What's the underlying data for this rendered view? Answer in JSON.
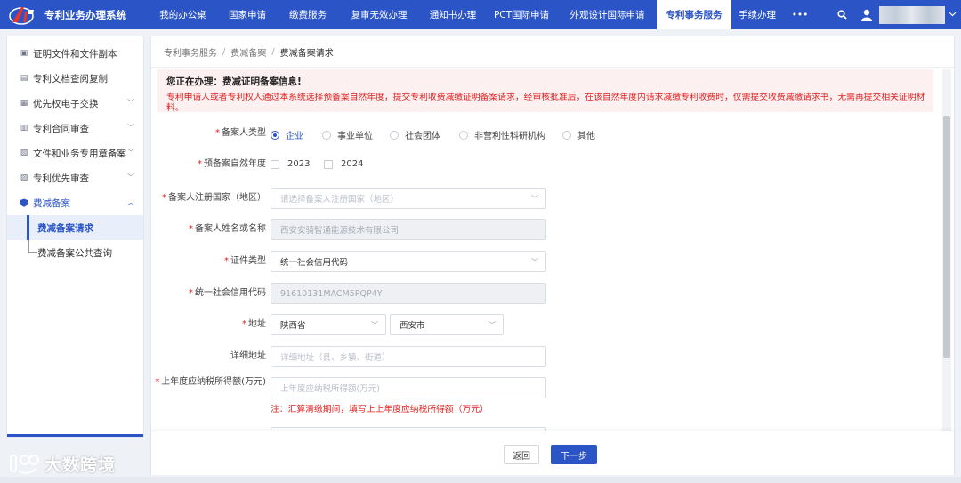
{
  "header": {
    "app_title": "专利业务办理系统",
    "nav": [
      "我的办公桌",
      "国家申请",
      "缴费服务",
      "复审无效办理",
      "通知书办理",
      "PCT国际申请",
      "外观设计国际申请",
      "专利事务服务",
      "手续办理",
      "•••"
    ],
    "active_nav": "专利事务服务",
    "brand_color": "#2b55c6"
  },
  "sidebar": {
    "items": [
      {
        "label": "证明文件和文件副本",
        "icon": "document-icon"
      },
      {
        "label": "专利文档查阅复制",
        "icon": "copy-icon"
      },
      {
        "label": "优先权电子交换",
        "icon": "exchange-icon"
      },
      {
        "label": "专利合同审查",
        "icon": "contract-icon"
      },
      {
        "label": "文件和业务专用章备案",
        "icon": "seal-icon"
      },
      {
        "label": "专利优先审查",
        "icon": "priority-icon"
      },
      {
        "label": "费减备案",
        "icon": "shield-icon"
      }
    ],
    "sub_items": [
      {
        "label": "费减备案请求",
        "active": true
      },
      {
        "label": "费减备案公共查询",
        "active": false
      }
    ]
  },
  "breadcrumb": [
    "专利事务服务",
    "费减备案",
    "费减备案请求"
  ],
  "notice": {
    "title": "您正在办理：费减证明备案信息!",
    "text": "专利申请人或者专利权人通过本系统选择预备案自然年度，提交专利收费减缴证明备案请求，经审核批准后，在该自然年度内请求减缴专利收费时，仅需提交收费减缴请求书，无需再提交相关证明材料。"
  },
  "form": {
    "filer_type": {
      "label": "备案人类型",
      "options": [
        "企业",
        "事业单位",
        "社会团体",
        "非营利性科研机构",
        "其他"
      ],
      "selected": "企业"
    },
    "year": {
      "label": "预备案自然年度",
      "options": [
        "2023",
        "2024"
      ]
    },
    "country": {
      "label": "备案人注册国家（地区）",
      "placeholder": "请选择备案人注册国家（地区）"
    },
    "name": {
      "label": "备案人姓名或名称",
      "value": "西安安骑智通能源技术有限公司"
    },
    "id_type": {
      "label": "证件类型",
      "value": "统一社会信用代码"
    },
    "credit_code": {
      "label": "统一社会信用代码",
      "value": "91610131MACM5PQP4Y"
    },
    "address": {
      "label": "地址",
      "province": "陕西省",
      "city": "西安市"
    },
    "detail_address": {
      "label": "详细地址",
      "placeholder": "详细地址（县、乡镇、街道）"
    },
    "income": {
      "label": "上年度应纳税所得额(万元)",
      "placeholder": "上年度应纳税所得额(万元)",
      "note": "注：汇算清缴期间，填写上上年度应纳税所得额（万元）"
    }
  },
  "buttons": {
    "back": "返回",
    "next": "下一步"
  },
  "watermark": "大数跨境"
}
